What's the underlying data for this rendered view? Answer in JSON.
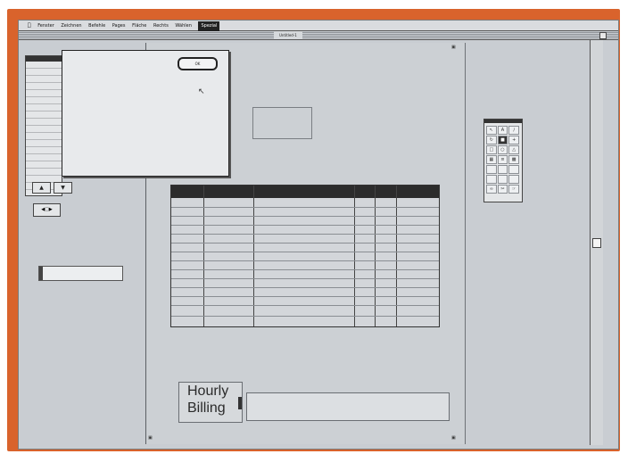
{
  "menu": {
    "items": [
      "Fenster",
      "Zeichnen",
      "Befehle",
      "Pages",
      "Fläche",
      "Rechts",
      "Wählen"
    ],
    "active": "Spezial"
  },
  "window": {
    "title": "Untitled-1"
  },
  "dialog": {
    "heading": "",
    "ok_label": "OK",
    "lines": [
      {
        "label": "",
        "value": ""
      },
      {
        "label": "",
        "value": ""
      },
      {
        "label": "",
        "value": ""
      },
      {
        "label": "",
        "value": ""
      },
      {
        "label": "",
        "value": ""
      },
      {
        "label": "",
        "value": ""
      },
      {
        "label": "",
        "value": ""
      },
      {
        "label": "",
        "value": ""
      },
      {
        "label": "",
        "value": ""
      }
    ]
  },
  "table": {
    "headers": [
      "",
      "",
      "",
      "",
      "",
      ""
    ],
    "row_count": 13
  },
  "hourly_billing": {
    "title_line1": "Hourly",
    "title_line2": "Billing",
    "info_title": "",
    "info_text": ""
  },
  "palette": {
    "tools": [
      "",
      "",
      "",
      "",
      "",
      "",
      "",
      "",
      "",
      "",
      "",
      "",
      "",
      "",
      "",
      "",
      "",
      "",
      "",
      "",
      ""
    ]
  },
  "colors": {
    "frame": "#d9632c",
    "screen": "#c9cdd2",
    "header": "#2c2c2c"
  }
}
